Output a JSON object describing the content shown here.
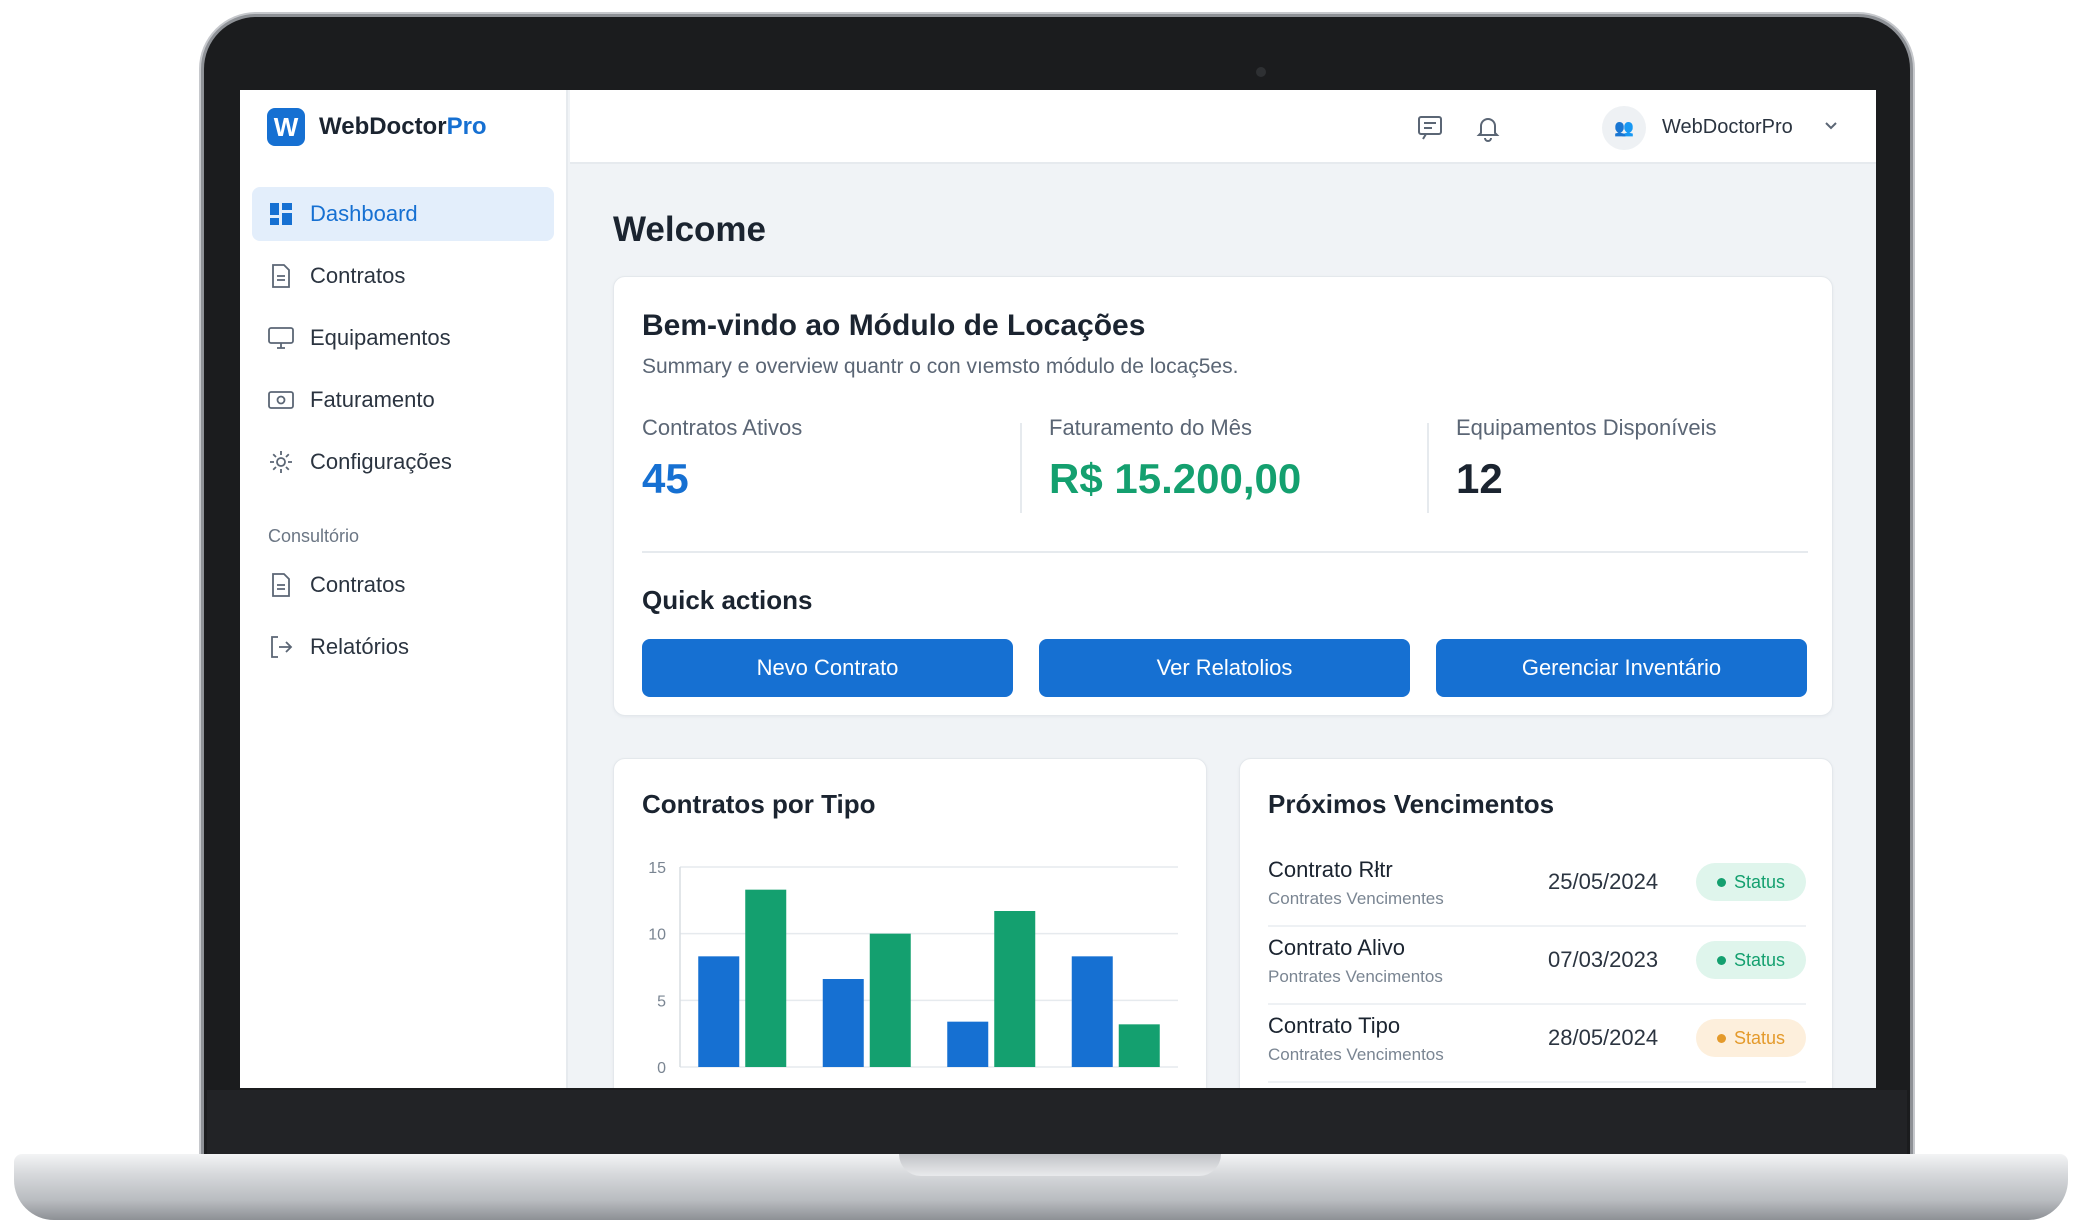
{
  "brand": {
    "name": "WebDoctor",
    "name_accent": "Pro",
    "logo_letter": "W"
  },
  "sidebar": {
    "items": [
      {
        "label": "Dashboard",
        "icon": "dashboard-icon"
      },
      {
        "label": "Contratos",
        "icon": "document-icon"
      },
      {
        "label": "Equipamentos",
        "icon": "monitor-icon"
      },
      {
        "label": "Faturamento",
        "icon": "billing-icon"
      },
      {
        "label": "Configurações",
        "icon": "gear-icon"
      }
    ],
    "section_label": "Consultório",
    "section_items": [
      {
        "label": "Contratos",
        "icon": "document-icon"
      },
      {
        "label": "Relatórios",
        "icon": "export-icon"
      }
    ]
  },
  "topbar": {
    "user_name": "WebDoctorPro",
    "avatar_text": "👥"
  },
  "main": {
    "welcome": "Welcome",
    "hero": {
      "title": "Bem-vindo ao Módulo de Locações",
      "subtitle": "Summary e overview quantr o con vıemsto módulo de locaç5es.",
      "stats": [
        {
          "label": "Contratos Ativos",
          "value": "45"
        },
        {
          "label": "Faturamento do Mês",
          "value": "R$ 15.200,00"
        },
        {
          "label": "Equipamentos Disponíveis",
          "value": "12"
        }
      ],
      "quick_actions_title": "Quick actions",
      "actions": [
        "Nevo Contrato",
        "Ver Relatolios",
        "Gerenciar Inventário"
      ]
    },
    "upcoming": {
      "title": "Próximos Vencimentos",
      "rows": [
        {
          "name": "Contrato Rłtr",
          "sub": "Contrates Vencimentes",
          "date": "25/05/2024",
          "status": "Status",
          "tone": "green"
        },
        {
          "name": "Contrato Alivo",
          "sub": "Pontrates Vencimentos",
          "date": "07/03/2023",
          "status": "Status",
          "tone": "green"
        },
        {
          "name": "Contrato Tipo",
          "sub": "Contrates Vencimentos",
          "date": "28/05/2024",
          "status": "Status",
          "tone": "amber"
        }
      ]
    }
  },
  "colors": {
    "primary": "#1670d2",
    "green": "#14a06f",
    "amber": "#e49a2b"
  },
  "chart_data": {
    "type": "bar",
    "title": "Contratos por Tipo",
    "categories": [
      "",
      "",
      "",
      ""
    ],
    "series": [
      {
        "values": [
          8.3,
          6.6,
          3.4,
          8.3
        ],
        "color": "#1670d2"
      },
      {
        "values": [
          13.3,
          10,
          11.7,
          3.2
        ],
        "color": "#14a06f"
      }
    ],
    "ylim": [
      0,
      15
    ],
    "yticks": [
      "0",
      "5",
      "10",
      "15"
    ],
    "grid": true
  }
}
